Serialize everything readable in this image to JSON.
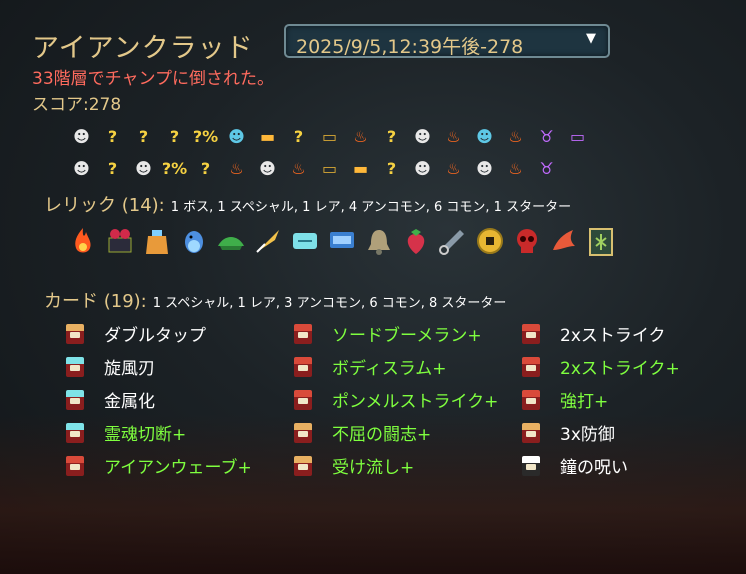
{
  "header": {
    "character": "アイアンクラッド",
    "run_select": "2025/9/5,12:39午後-278",
    "death_text": "33階層でチャンプに倒された。",
    "score_text": "スコア:278"
  },
  "path": {
    "row1": [
      "monster",
      "unknown",
      "unknown",
      "unknown",
      "event",
      "shop",
      "rest",
      "unknown",
      "treasure",
      "elite",
      "unknown",
      "monster",
      "elite",
      "shop",
      "elite",
      "boss",
      "chest"
    ],
    "row2": [
      "monster",
      "unknown",
      "monster",
      "event",
      "unknown",
      "elite",
      "monster",
      "elite",
      "treasure",
      "rest",
      "unknown",
      "monster",
      "elite",
      "monster",
      "elite",
      "boss"
    ]
  },
  "relics_section": {
    "label": "レリック (14):",
    "summary": "1 ボス, 1 スペシャル, 1 レア, 4 アンコモン, 6 コモン, 1 スターター",
    "items": [
      "burning-blood",
      "black-box",
      "bag-of-prep",
      "blue-bird",
      "turnip",
      "feather-pen",
      "ticket",
      "pillow",
      "bell",
      "strawberry",
      "kunai",
      "coin",
      "red-skull",
      "red-hand",
      "specimen"
    ]
  },
  "cards_section": {
    "label": "カード (19):",
    "summary": "1 スペシャル, 1 レア, 3 アンコモン, 6 コモン, 8 スターター",
    "columns": [
      [
        {
          "name": "ダブルタップ",
          "upgraded": false,
          "type": "skill"
        },
        {
          "name": "旋風刃",
          "upgraded": false,
          "type": "attack-rare"
        },
        {
          "name": "金属化",
          "upgraded": false,
          "type": "power"
        },
        {
          "name": "霊魂切断+",
          "upgraded": true,
          "type": "attack-rare"
        },
        {
          "name": "アイアンウェーブ+",
          "upgraded": true,
          "type": "attack"
        }
      ],
      [
        {
          "name": "ソードブーメラン+",
          "upgraded": true,
          "type": "attack"
        },
        {
          "name": "ボディスラム+",
          "upgraded": true,
          "type": "attack"
        },
        {
          "name": "ポンメルストライク+",
          "upgraded": true,
          "type": "attack"
        },
        {
          "name": "不屈の闘志+",
          "upgraded": true,
          "type": "skill"
        },
        {
          "name": "受け流し+",
          "upgraded": true,
          "type": "skill"
        }
      ],
      [
        {
          "name": "2xストライク",
          "upgraded": false,
          "type": "attack"
        },
        {
          "name": "2xストライク+",
          "upgraded": true,
          "type": "attack"
        },
        {
          "name": "強打+",
          "upgraded": true,
          "type": "attack"
        },
        {
          "name": "3x防御",
          "upgraded": false,
          "type": "skill"
        },
        {
          "name": "鐘の呪い",
          "upgraded": false,
          "type": "curse"
        }
      ]
    ]
  },
  "colors": {
    "gold": "#e3c88a",
    "red": "#ff6b5e",
    "green_upgraded": "#7fff3f"
  }
}
